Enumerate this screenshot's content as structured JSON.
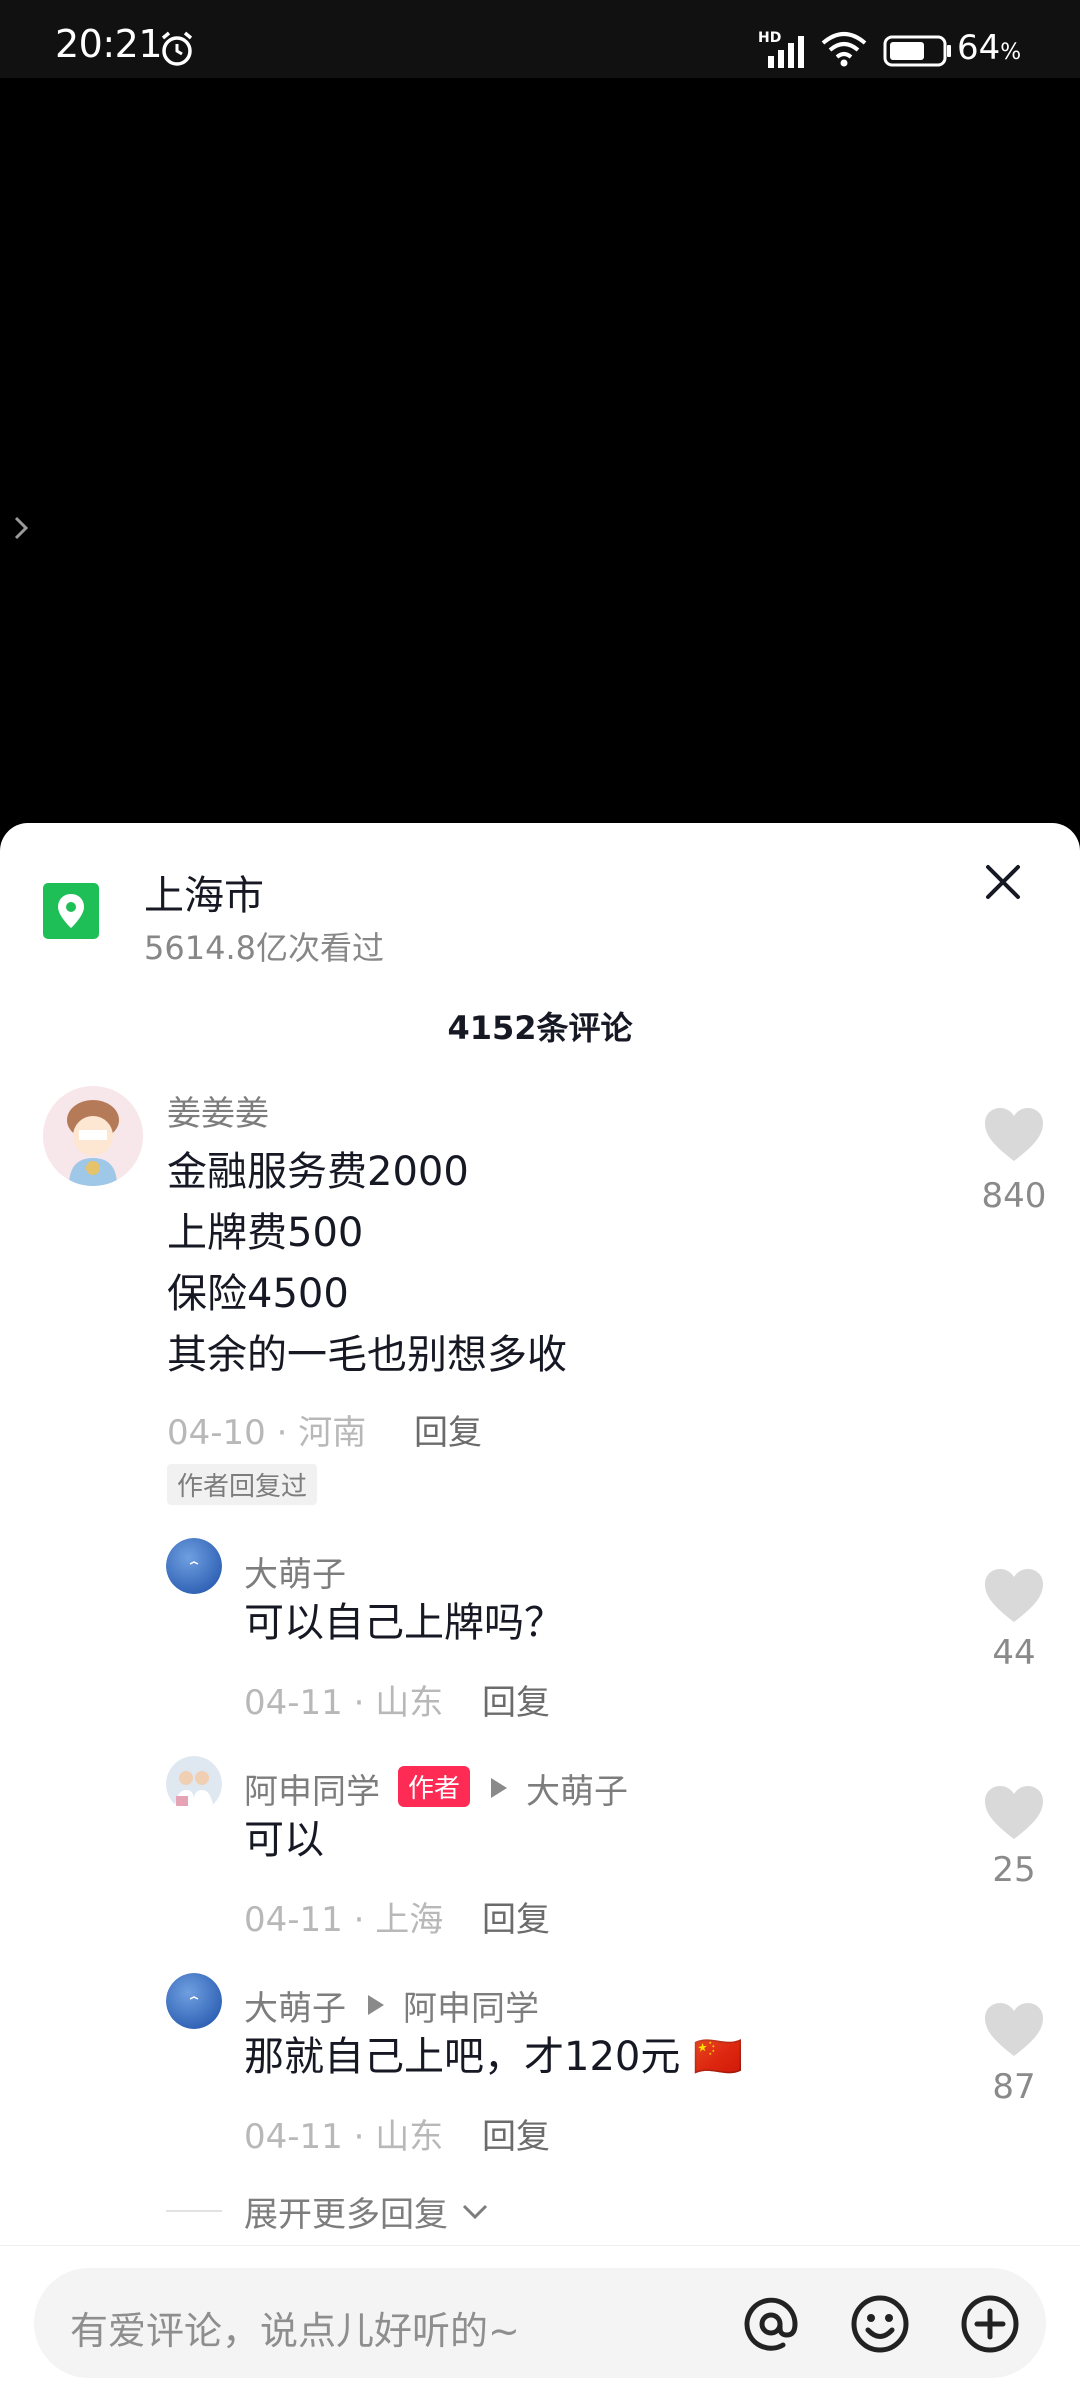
{
  "status_bar": {
    "time": "20:21",
    "network_label": "HD",
    "battery_percent": "64",
    "battery_unit": "%"
  },
  "location": {
    "title": "上海市",
    "views": "5614.8亿次看过"
  },
  "comments_header": {
    "count_label": "4152条评论"
  },
  "comments": [
    {
      "author": "姜姜姜",
      "text_lines": [
        "金融服务费2000",
        "上牌费500",
        "保险4500",
        "其余的一毛也别想多收"
      ],
      "date": "04-10",
      "region": "河南",
      "reply_label": "回复",
      "author_replied_tag": "作者回复过",
      "likes": "840",
      "replies": [
        {
          "author": "大萌子",
          "text": "可以自己上牌吗？",
          "date": "04-11",
          "region": "山东",
          "reply_label": "回复",
          "likes": "44"
        },
        {
          "author": "阿申同学",
          "badge": "作者",
          "reply_to": "大萌子",
          "text": "可以",
          "date": "04-11",
          "region": "上海",
          "reply_label": "回复",
          "likes": "25"
        },
        {
          "author": "大萌子",
          "reply_to": "阿申同学",
          "text": "那就自己上吧，才120元 🇨🇳",
          "date": "04-11",
          "region": "山东",
          "reply_label": "回复",
          "likes": "87"
        }
      ],
      "expand_more": "展开更多回复"
    }
  ],
  "input": {
    "placeholder": "有爱评论，说点儿好听的~",
    "icons": [
      "at-icon",
      "emoji-icon",
      "add-icon"
    ]
  },
  "colors": {
    "accent": "#fe2c55",
    "location_green": "#1fbf57",
    "like_gray": "#d9d9d9"
  }
}
